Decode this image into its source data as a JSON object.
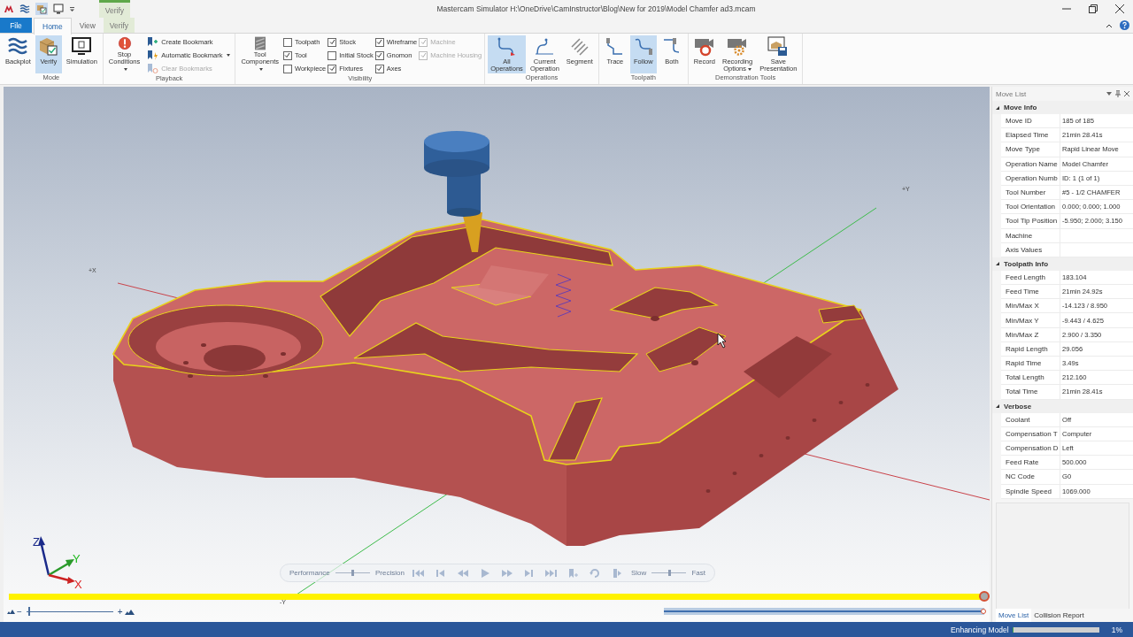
{
  "window": {
    "title": "Mastercam Simulator  H:\\OneDrive\\CamInstructor\\Blog\\New for 2019\\Model Chamfer ad3.mcam",
    "context_group": "Verify"
  },
  "tabs": [
    {
      "label": "File",
      "kind": "file",
      "selected": false
    },
    {
      "label": "Home",
      "kind": "tab",
      "selected": true
    },
    {
      "label": "View",
      "kind": "tab",
      "selected": false
    },
    {
      "label": "Verify",
      "kind": "context",
      "selected": false
    }
  ],
  "ribbon": [
    {
      "label": "Mode",
      "items": [
        {
          "kind": "large",
          "label": "Backplot",
          "menu": false,
          "selected": false
        },
        {
          "kind": "large",
          "label": "Verify",
          "menu": false,
          "selected": true
        },
        {
          "kind": "large",
          "label": "Simulation",
          "menu": false,
          "selected": false
        }
      ]
    },
    {
      "label": "Playback",
      "items": [
        {
          "kind": "large",
          "label": "Stop Conditions",
          "menu": true,
          "selected": false
        },
        {
          "kind": "stack",
          "items": [
            {
              "label": "Create Bookmark",
              "menu": false,
              "disabled": false
            },
            {
              "label": "Automatic Bookmark",
              "menu": true,
              "disabled": false
            },
            {
              "label": "Clear Bookmarks",
              "menu": false,
              "disabled": true
            }
          ]
        }
      ]
    },
    {
      "label": "Visibility",
      "items": [
        {
          "kind": "large",
          "label": "Tool Components",
          "menu": true,
          "selected": false
        },
        {
          "kind": "checks",
          "items": [
            {
              "label": "Toolpath",
              "checked": false,
              "disabled": false
            },
            {
              "label": "Tool",
              "checked": true,
              "disabled": false
            },
            {
              "label": "Workpiece",
              "checked": false,
              "disabled": false
            }
          ]
        },
        {
          "kind": "checks",
          "items": [
            {
              "label": "Stock",
              "checked": true,
              "disabled": false
            },
            {
              "label": "Initial Stock",
              "checked": false,
              "disabled": false
            },
            {
              "label": "Fixtures",
              "checked": true,
              "disabled": false
            }
          ]
        },
        {
          "kind": "checks",
          "items": [
            {
              "label": "Wireframe",
              "checked": true,
              "disabled": false
            },
            {
              "label": "Gnomon",
              "checked": true,
              "disabled": false
            },
            {
              "label": "Axes",
              "checked": true,
              "disabled": false
            }
          ]
        },
        {
          "kind": "checks",
          "items": [
            {
              "label": "Machine",
              "checked": true,
              "disabled": true
            },
            {
              "label": "Machine Housing",
              "checked": true,
              "disabled": true
            }
          ]
        }
      ]
    },
    {
      "label": "Operations",
      "items": [
        {
          "kind": "large",
          "label": "All Operations",
          "menu": false,
          "selected": true
        },
        {
          "kind": "large",
          "label": "Current Operation",
          "menu": false,
          "selected": false
        },
        {
          "kind": "large",
          "label": "Segment",
          "menu": false,
          "selected": false
        }
      ]
    },
    {
      "label": "Toolpath",
      "items": [
        {
          "kind": "large",
          "label": "Trace",
          "menu": false,
          "selected": false
        },
        {
          "kind": "large",
          "label": "Follow",
          "menu": false,
          "selected": true
        },
        {
          "kind": "large",
          "label": "Both",
          "menu": false,
          "selected": false
        }
      ]
    },
    {
      "label": "Demonstration Tools",
      "items": [
        {
          "kind": "large",
          "label": "Record",
          "menu": false,
          "selected": false
        },
        {
          "kind": "large",
          "label": "Recording Options",
          "menu": true,
          "selected": false
        },
        {
          "kind": "large",
          "label": "Save Presentation",
          "menu": false,
          "selected": false
        }
      ]
    }
  ],
  "viewport": {
    "axis_labels": [
      {
        "kind": "x",
        "text": "+X"
      },
      {
        "kind": "y",
        "text": "+Y"
      },
      {
        "kind": "negy",
        "text": "-Y"
      }
    ],
    "gnomon": {
      "x": "X",
      "y": "Y",
      "z": "Z"
    },
    "playback": {
      "disabled": true,
      "quality": {
        "left": "Performance",
        "right": "Precision",
        "level": 0.5
      },
      "speed": {
        "left": "Slow",
        "right": "Fast",
        "level": 0.5
      }
    },
    "timeline": {
      "level": 1
    },
    "zoom": {
      "minus": "−",
      "plus": "+",
      "level": 0.02
    },
    "range": {
      "level": 1
    }
  },
  "move_list": {
    "title": "Move List",
    "sections": [
      {
        "title": "Move Info",
        "expanded": true,
        "rows": [
          {
            "name": "Move ID",
            "value": "185 of 185"
          },
          {
            "name": "Elapsed Time",
            "value": "21min 28.41s"
          },
          {
            "name": "Move Type",
            "value": "Rapid Linear Move"
          },
          {
            "name": "Operation Name",
            "value": "Model Chamfer"
          },
          {
            "name": "Operation Numb",
            "value": "ID: 1 (1 of 1)"
          },
          {
            "name": "Tool Number",
            "value": "#5 - 1/2 CHAMFER"
          },
          {
            "name": "Tool Orientation",
            "value": "0.000; 0.000; 1.000"
          },
          {
            "name": "Tool Tip Position",
            "value": "-5.950; 2.000; 3.150"
          },
          {
            "name": "Machine",
            "value": ""
          },
          {
            "name": "Axis Values",
            "value": ""
          }
        ]
      },
      {
        "title": "Toolpath Info",
        "expanded": true,
        "rows": [
          {
            "name": "Feed Length",
            "value": "183.104"
          },
          {
            "name": "Feed Time",
            "value": "21min 24.92s"
          },
          {
            "name": "Min/Max X",
            "value": "-14.123 / 8.950"
          },
          {
            "name": "Min/Max Y",
            "value": "-9.443 / 4.625"
          },
          {
            "name": "Min/Max Z",
            "value": "2.900 / 3.350"
          },
          {
            "name": "Rapid Length",
            "value": "29.056"
          },
          {
            "name": "Rapid Time",
            "value": "3.49s"
          },
          {
            "name": "Total Length",
            "value": "212.160"
          },
          {
            "name": "Total Time",
            "value": "21min 28.41s"
          }
        ]
      },
      {
        "title": "Verbose",
        "expanded": true,
        "rows": [
          {
            "name": "Coolant",
            "value": "Off"
          },
          {
            "name": "Compensation T",
            "value": "Computer"
          },
          {
            "name": "Compensation D",
            "value": "Left"
          },
          {
            "name": "Feed Rate",
            "value": "500.000"
          },
          {
            "name": "NC Code",
            "value": "G0"
          },
          {
            "name": "Spindle Speed",
            "value": "1069.000"
          }
        ]
      }
    ],
    "tabs": [
      {
        "label": "Move List",
        "selected": true
      },
      {
        "label": "Collision Report",
        "selected": false
      }
    ]
  },
  "status_bar": {
    "text": "Enhancing Model",
    "level": 0.01,
    "percent": "1%"
  }
}
